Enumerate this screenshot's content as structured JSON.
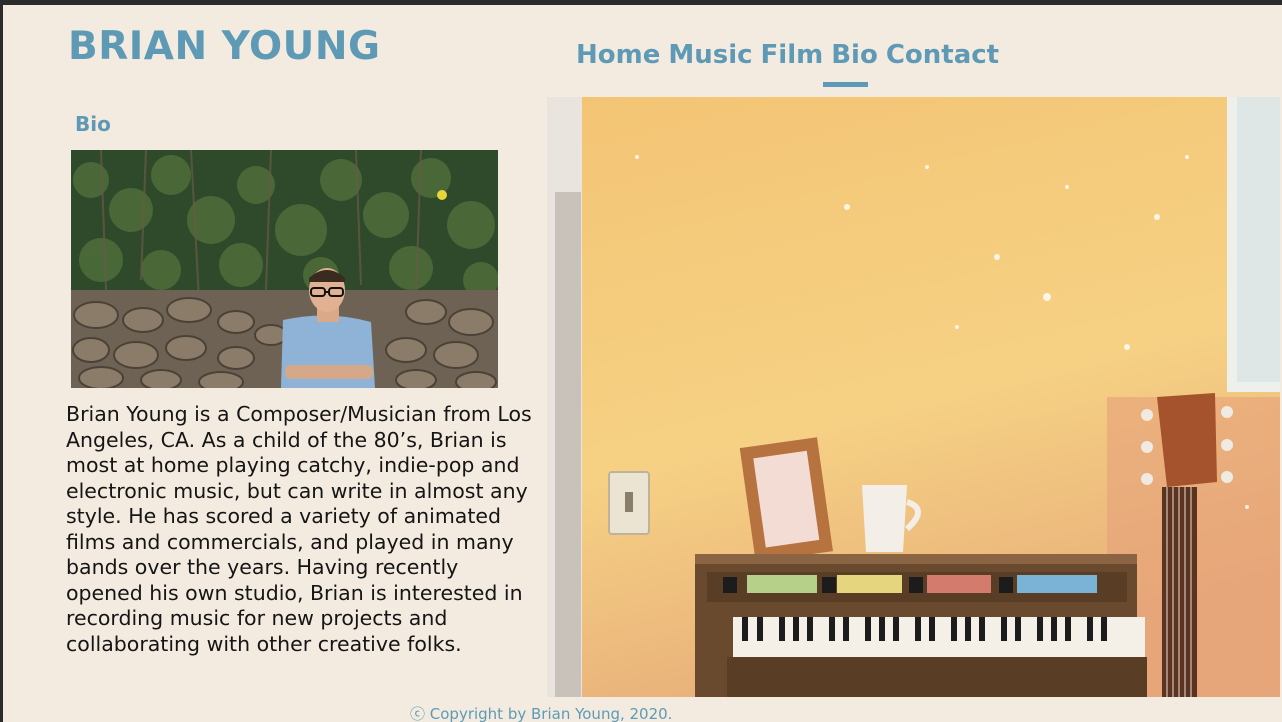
{
  "header": {
    "site_title": "BRIAN YOUNG",
    "nav": [
      "Home",
      "Music",
      "Film",
      "Bio",
      "Contact"
    ],
    "active_nav": "Bio"
  },
  "main": {
    "section_heading": "Bio",
    "bio_text": "Brian Young is a Composer/Musician from Los Angeles, CA. As a child of the 80’s, Brian is most at home playing catchy, indie-pop and electronic music, but can write in almost any style. He  has scored a variety of animated films and commercials, and played in many bands over the years. Having recently opened his own studio, Brian is interested in recording music for new projects and collaborating with other creative folks."
  },
  "footer": {
    "copyright": "ⓒ Copyright by Brian Young, 2020."
  },
  "colors": {
    "accent": "#5e9ab6",
    "background": "#f3ebdf",
    "text": "#151515"
  }
}
